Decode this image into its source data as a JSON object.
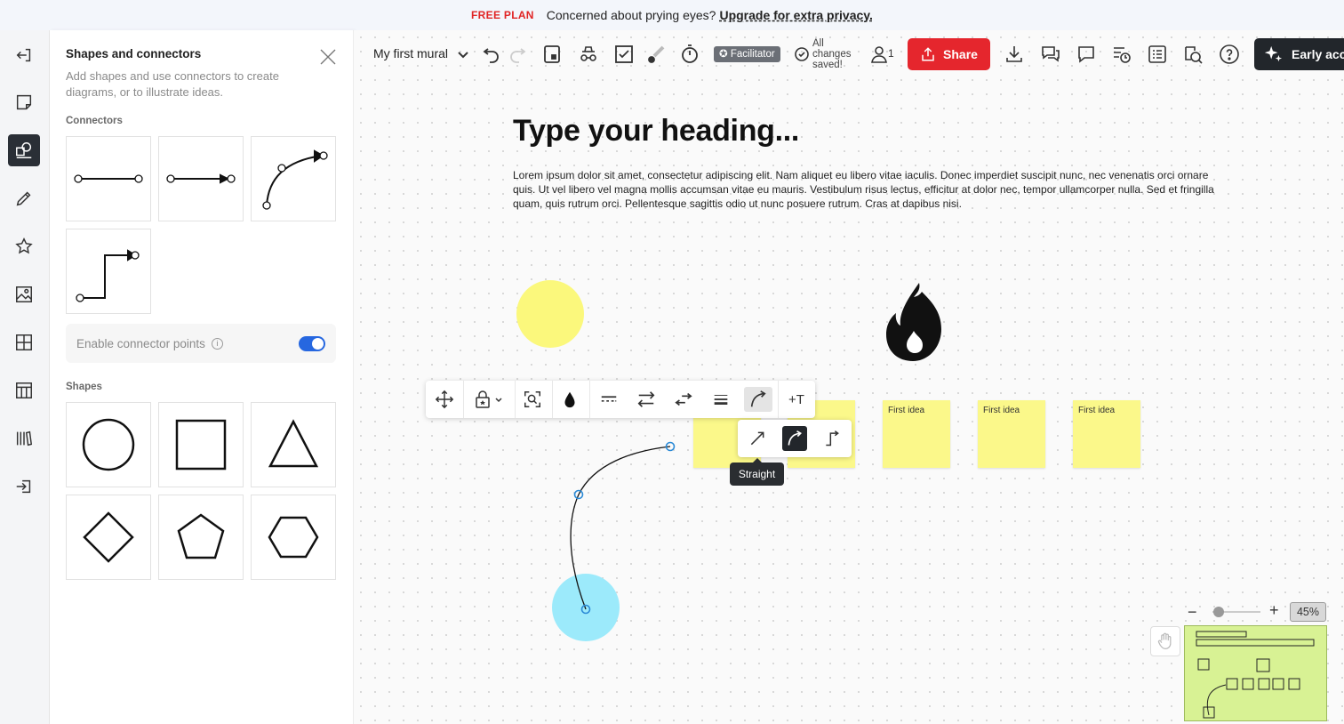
{
  "banner": {
    "plan": "FREE PLAN",
    "message": "Concerned about prying eyes?",
    "upgrade": "Upgrade for extra privacy."
  },
  "rail": {
    "items": [
      "exit-icon",
      "sticky-note-icon",
      "shapes-connectors-icon",
      "pen-icon",
      "star-icon",
      "image-icon",
      "grid-icon",
      "table-icon",
      "library-icon",
      "import-icon"
    ],
    "active": "shapes-connectors-icon"
  },
  "panel": {
    "title": "Shapes and connectors",
    "description": "Add shapes and use connectors to create diagrams, or to illustrate ideas.",
    "connectors_label": "Connectors",
    "toggle_label": "Enable connector points",
    "toggle_on": true,
    "shapes_label": "Shapes"
  },
  "toolbar": {
    "mural_name": "My first mural",
    "facilitator": "Facilitator",
    "saved": "All changes saved!",
    "members": "1",
    "share": "Share",
    "early": "Early acc"
  },
  "canvas": {
    "heading": "Type your heading...",
    "body": "Lorem ipsum dolor sit amet, consectetur adipiscing elit. Nam aliquet eu libero vitae iaculis. Donec imperdiet suscipit nunc, nec venenatis orci ornare quis. Ut vel libero vel magna mollis accumsan vitae eu mauris. Vestibulum risus lectus, efficitur at dolor nec, tempor ullamcorper nulla. Sed et fringilla quam, quis rutrum orci. Pellentesque sagittis odio ut nunc posuere rutrum. Cras at dapibus nisi.",
    "stickies": [
      {
        "text": ""
      },
      {
        "text": "dea"
      },
      {
        "text": "First idea"
      },
      {
        "text": "First idea"
      },
      {
        "text": "First idea"
      }
    ],
    "tooltip": "Straight",
    "text_tool": "+T"
  },
  "zoom": {
    "level": "45%",
    "minus": "−",
    "plus": "+"
  },
  "colors": {
    "accent": "#e5262d",
    "sticky": "#fbf88a",
    "yellow_circle": "#fbf87c",
    "blue_circle": "#9ceafb",
    "minimap": "#d8f294",
    "toggle": "#2667e0"
  }
}
